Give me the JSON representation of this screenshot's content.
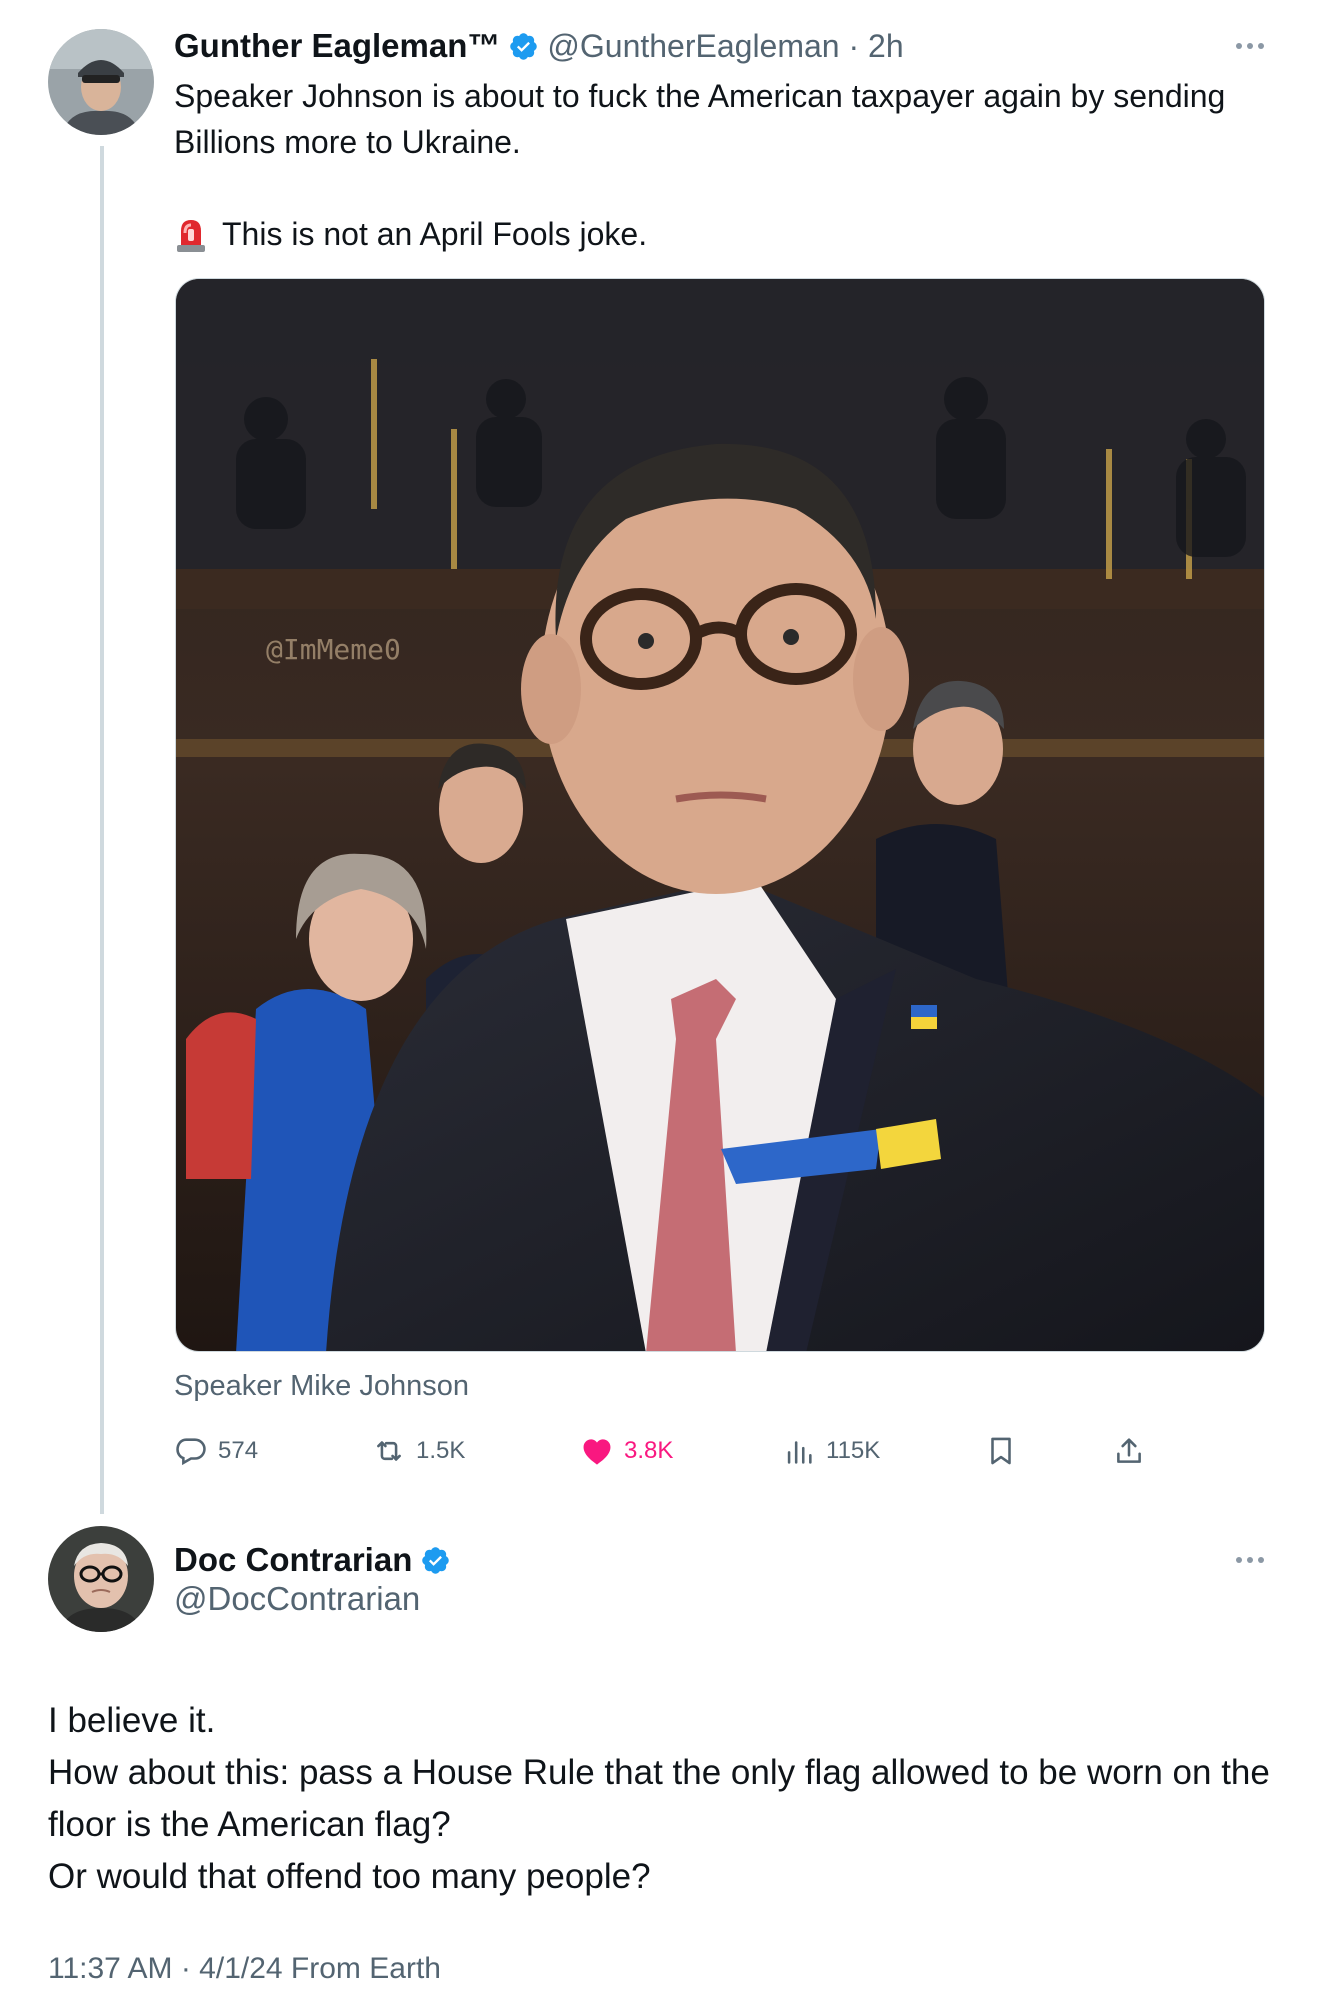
{
  "post": {
    "author_name": "Gunther Eagleman™",
    "author_handle": "@GuntherEagleman",
    "time": "2h",
    "text_line_1": "Speaker Johnson is about to fuck the American taxpayer again by sending Billions more to Ukraine.",
    "text_line_2": "This is not an April Fools joke.",
    "siren_icon": "rotating-light-emoji",
    "image_watermark": "@ImMeme0",
    "image_caption": "Speaker Mike Johnson",
    "stats": {
      "replies": "574",
      "reposts": "1.5K",
      "likes": "3.8K",
      "views": "115K"
    }
  },
  "reply": {
    "author_name": "Doc Contrarian",
    "author_handle": "@DocContrarian",
    "lines": [
      "I believe it.",
      "How about this: pass a House Rule that the only flag allowed to be worn on the floor is the American flag?",
      "Or would that offend too many people?"
    ],
    "timestamp": "11:37 AM · 4/1/24 From Earth"
  },
  "colors": {
    "verified_blue": "#1d9bf0",
    "like_pink": "#f91880",
    "secondary_text": "#536471",
    "thread_line": "#cfd9de"
  }
}
